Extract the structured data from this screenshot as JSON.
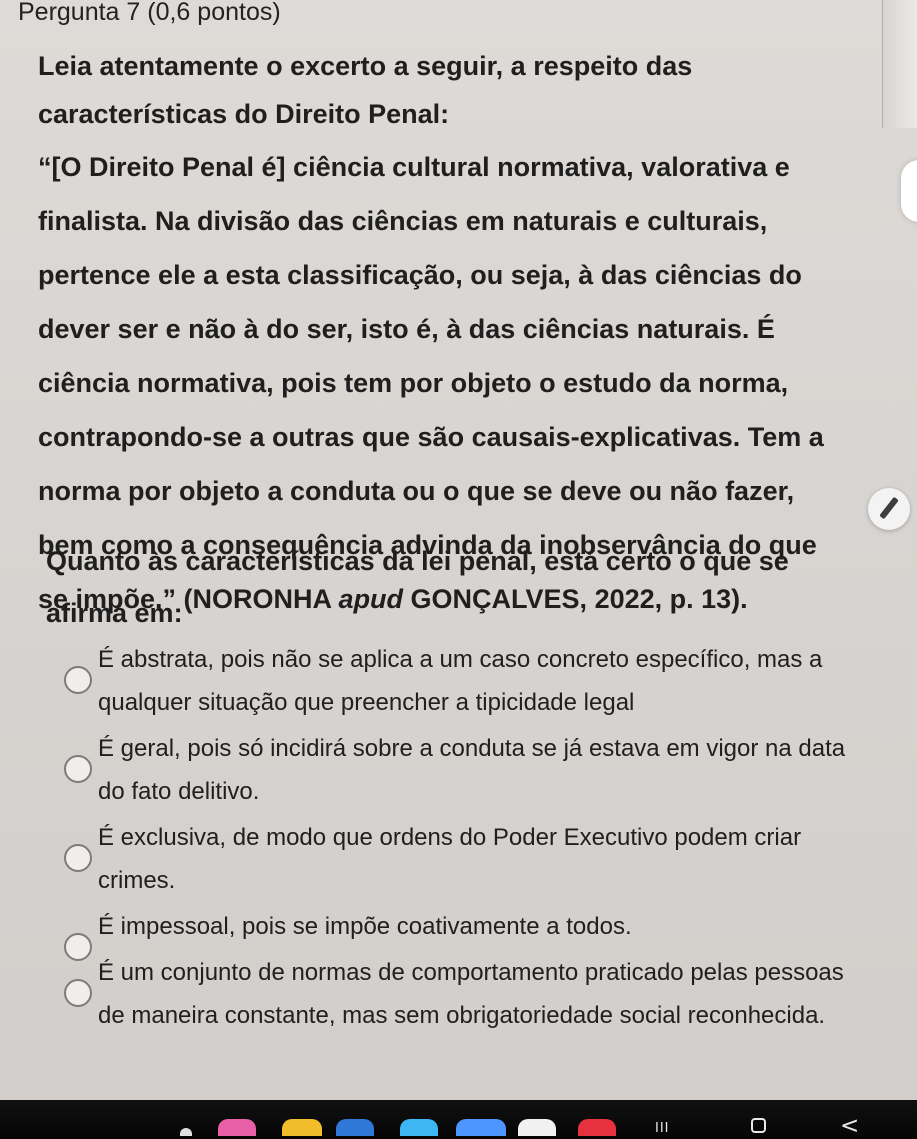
{
  "question": {
    "title": "Pergunta 7 (0,6 pontos)",
    "intro": "Leia atentamente o excerto a seguir, a respeito das características do Direito Penal:",
    "quote_before_italic": "“[O Direito Penal é] ciência cultural normativa, valorativa e finalista. Na divisão das ciências em naturais e culturais, pertence ele a esta classificação, ou seja, à das ciências do dever ser e não à do ser, isto é, à das ciências naturais. É ciência normativa, pois tem por objeto o estudo da norma, contrapondo-se a outras que são causais-explicativas. Tem a norma por objeto a conduta ou o que se deve ou não fazer, bem como a consequência advinda da inobservância do que se impõe.” (NORONHA ",
    "quote_italic": "apud",
    "quote_after_italic": " GONÇALVES, 2022, p. 13).",
    "prompt": "Quanto às características da lei penal, está certo o que se afirma em:"
  },
  "options": [
    {
      "label": "É abstrata, pois não se aplica a um caso concreto específico, mas a qualquer situação que preencher a tipicidade legal"
    },
    {
      "label": "É geral, pois só incidirá sobre a conduta se já estava em vigor na data do fato delitivo."
    },
    {
      "label": "É exclusiva, de modo que ordens do Poder Executivo podem criar crimes."
    },
    {
      "label": "É impessoal, pois se impõe coativamente a todos."
    },
    {
      "label": "É um conjunto de normas de comportamento praticado pelas pessoas de maneira constante, mas sem obrigatoriedade social reconhecida."
    }
  ],
  "system_nav": {
    "recent_apps_symbol": "III",
    "back_symbol": "<"
  },
  "colors": {
    "page_background": "#d7d3d0",
    "text": "#1f1f1f",
    "radio_border": "#7e7b79",
    "navigation_bar": "#050505"
  },
  "icons": [
    "pen-icon",
    "recent-apps-icon",
    "home-icon",
    "back-icon"
  ]
}
